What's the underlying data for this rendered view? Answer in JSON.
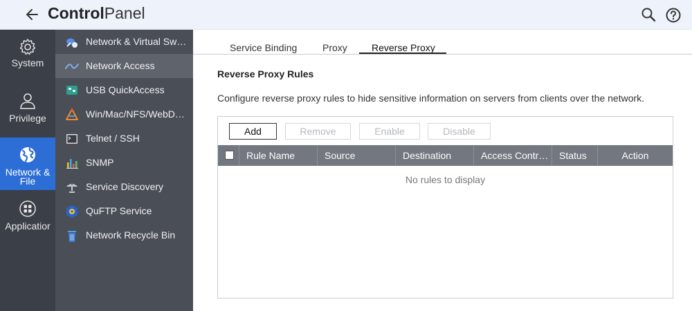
{
  "header": {
    "title_bold": "Control",
    "title_light": "Panel"
  },
  "rail": {
    "items": [
      {
        "label": "System",
        "icon": "gear-icon"
      },
      {
        "label": "Privilege",
        "icon": "user-icon"
      },
      {
        "label_line1": "Network &",
        "label_line2": "File",
        "icon": "globe-icon",
        "active": true
      },
      {
        "label": "Applicatior",
        "icon": "apps-grid-icon"
      }
    ]
  },
  "subnav": {
    "items": [
      {
        "label": "Network & Virtual Sw…",
        "icon": "network-switch-icon"
      },
      {
        "label": "Network Access",
        "icon": "network-access-icon",
        "active": true
      },
      {
        "label": "USB QuickAccess",
        "icon": "usb-quickaccess-icon"
      },
      {
        "label": "Win/Mac/NFS/WebD…",
        "icon": "win-mac-nfs-icon"
      },
      {
        "label": "Telnet / SSH",
        "icon": "terminal-icon"
      },
      {
        "label": "SNMP",
        "icon": "snmp-chart-icon"
      },
      {
        "label": "Service Discovery",
        "icon": "satellite-dish-icon"
      },
      {
        "label": "QuFTP Service",
        "icon": "ftp-icon"
      },
      {
        "label": "Network Recycle Bin",
        "icon": "recycle-bin-icon"
      }
    ]
  },
  "tabs": [
    {
      "label": "Service Binding"
    },
    {
      "label": "Proxy"
    },
    {
      "label": "Reverse Proxy",
      "active": true
    }
  ],
  "content": {
    "section_title": "Reverse Proxy Rules",
    "description": "Configure reverse proxy rules to hide sensitive information on servers from clients over the network.",
    "buttons": {
      "add": "Add",
      "remove": "Remove",
      "enable": "Enable",
      "disable": "Disable"
    },
    "columns": [
      "Rule Name",
      "Source",
      "Destination",
      "Access Contr…",
      "Status",
      "Action"
    ],
    "empty_message": "No rules to display"
  },
  "colors": {
    "header_bg": "#eef2fb",
    "rail_bg": "#3b3f47",
    "rail_active": "#2c6ed5",
    "subnav_bg": "#4a4e57",
    "subnav_active": "#5f636c",
    "table_header": "#73777f"
  }
}
